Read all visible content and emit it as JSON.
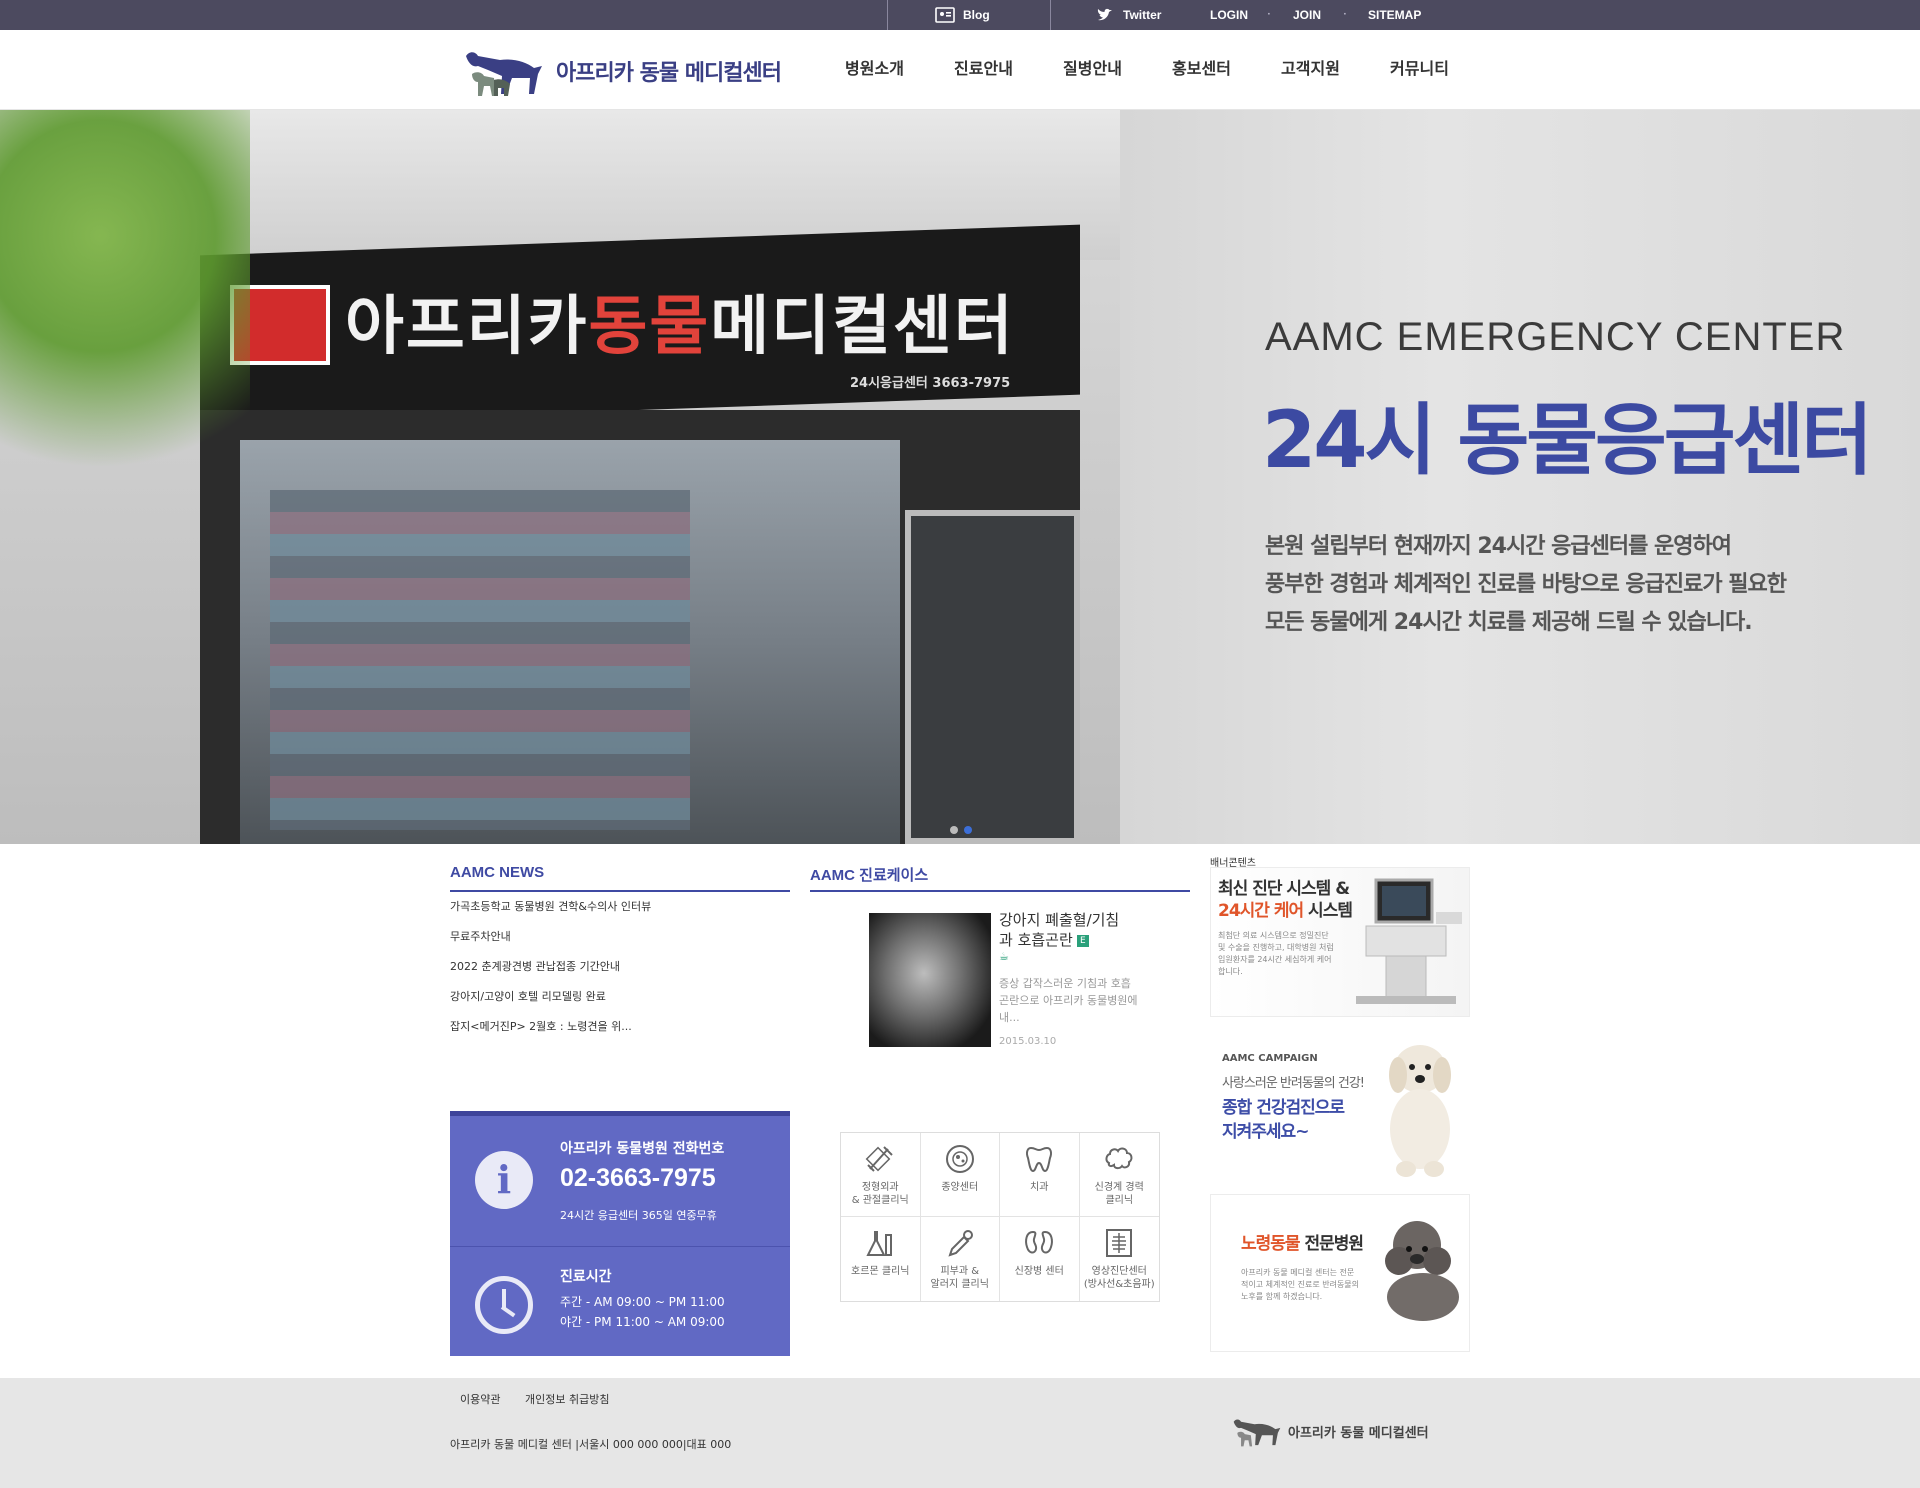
{
  "topbar": {
    "blog": "Blog",
    "twitter": "Twitter",
    "login": "LOGIN",
    "join": "JOIN",
    "sitemap": "SITEMAP",
    "dot": "·"
  },
  "header": {
    "logo_text": "아프리카 동물 메디컬센터",
    "nav": [
      "병원소개",
      "진료안내",
      "질병안내",
      "홍보센터",
      "고객지원",
      "커뮤니티"
    ]
  },
  "hero": {
    "sign_text_1": "아프리카",
    "sign_text_2": "동물",
    "sign_text_3": "메디컬센터",
    "sign_phone": "24시응급센터 3663-7975",
    "subtitle": "AAMC EMERGENCY CENTER",
    "title": "24시 동물응급센터",
    "desc": [
      "본원 설립부터 현재까지 24시간 응급센터를 운영하여",
      "풍부한 경험과 체계적인 진료를 바탕으로 응급진료가 필요한",
      "모든 동물에게 24시간 치료를 제공해 드릴 수 있습니다."
    ],
    "slide_count": 2,
    "active_slide": 1
  },
  "news": {
    "title": "AAMC NEWS",
    "items": [
      "가곡초등학교 동물병원 견학&수의사 인터뷰",
      "무료주차안내",
      "2022 춘계광견병 관납접종 기간안내",
      "강아지/고양이 호텔 리모델링 완료",
      "잡지<메거진P> 2월호 : 노령견을 위..."
    ]
  },
  "case": {
    "title": "AAMC 진료케이스",
    "item_title": "강아지 폐출혈/기침과 호흡곤란",
    "badge": "E",
    "desc": "증상 갑작스러운 기침과 호흡곤란으로 아프리카 동물병원에 내...",
    "date": "2015.03.10"
  },
  "info": {
    "phone_label": "아프리카 동물병원 전화번호",
    "phone": "02-3663-7975",
    "phone_note": "24시간 응급센터 365일 연중무휴",
    "hours_label": "진료시간",
    "hours_day": "주간 - AM 09:00 ~ PM 11:00",
    "hours_night": "야간 - PM 11:00 ~ AM 09:00"
  },
  "clinics": [
    {
      "label": "정형외과\n& 관절클리닉",
      "icon": "bone-icon"
    },
    {
      "label": "종양센터",
      "icon": "cell-icon"
    },
    {
      "label": "치과",
      "icon": "tooth-icon"
    },
    {
      "label": "신경계 경력\n클리닉",
      "icon": "brain-icon"
    },
    {
      "label": "호르몬 클리닉",
      "icon": "flask-icon"
    },
    {
      "label": "피부과 &\n알러지 클리닉",
      "icon": "dropper-icon"
    },
    {
      "label": "신장병 센터",
      "icon": "kidney-icon"
    },
    {
      "label": "영상진단센터\n(방사선&초음파)",
      "icon": "xray-icon"
    }
  ],
  "banners": {
    "label": "배너콘텐츠",
    "b1_line1": "최신 진단 시스템 &",
    "b1_line2a": "24시간 케어",
    "b1_line2b": " 시스템",
    "b1_small": "최첨단 의료 시스템으로 정밀진단 및 수술을 진행하고, 대학병원 처럼 입원환자를 24시간 세심하게 케어 합니다.",
    "b2_tag": "AAMC CAMPAIGN",
    "b2_line1": "사랑스러운 반려동물의 건강!",
    "b2_line2": "종합 건강검진으로",
    "b2_line3": "지켜주세요~",
    "b3_line_a": "노령동물",
    "b3_line_b": " 전문병원",
    "b3_small": "아프리카 동물 메디컬 센터는 전문적이고 체계적인 진료로 반려동물의 노후를 함께 하겠습니다."
  },
  "footer": {
    "terms": "이용약관",
    "privacy": "개인정보 취급방침",
    "address": "아프리카 동물 메디컬 센터 |서울시 000 000 000|대표 000",
    "logo_text": "아프리카 동물 메디컬센터"
  }
}
